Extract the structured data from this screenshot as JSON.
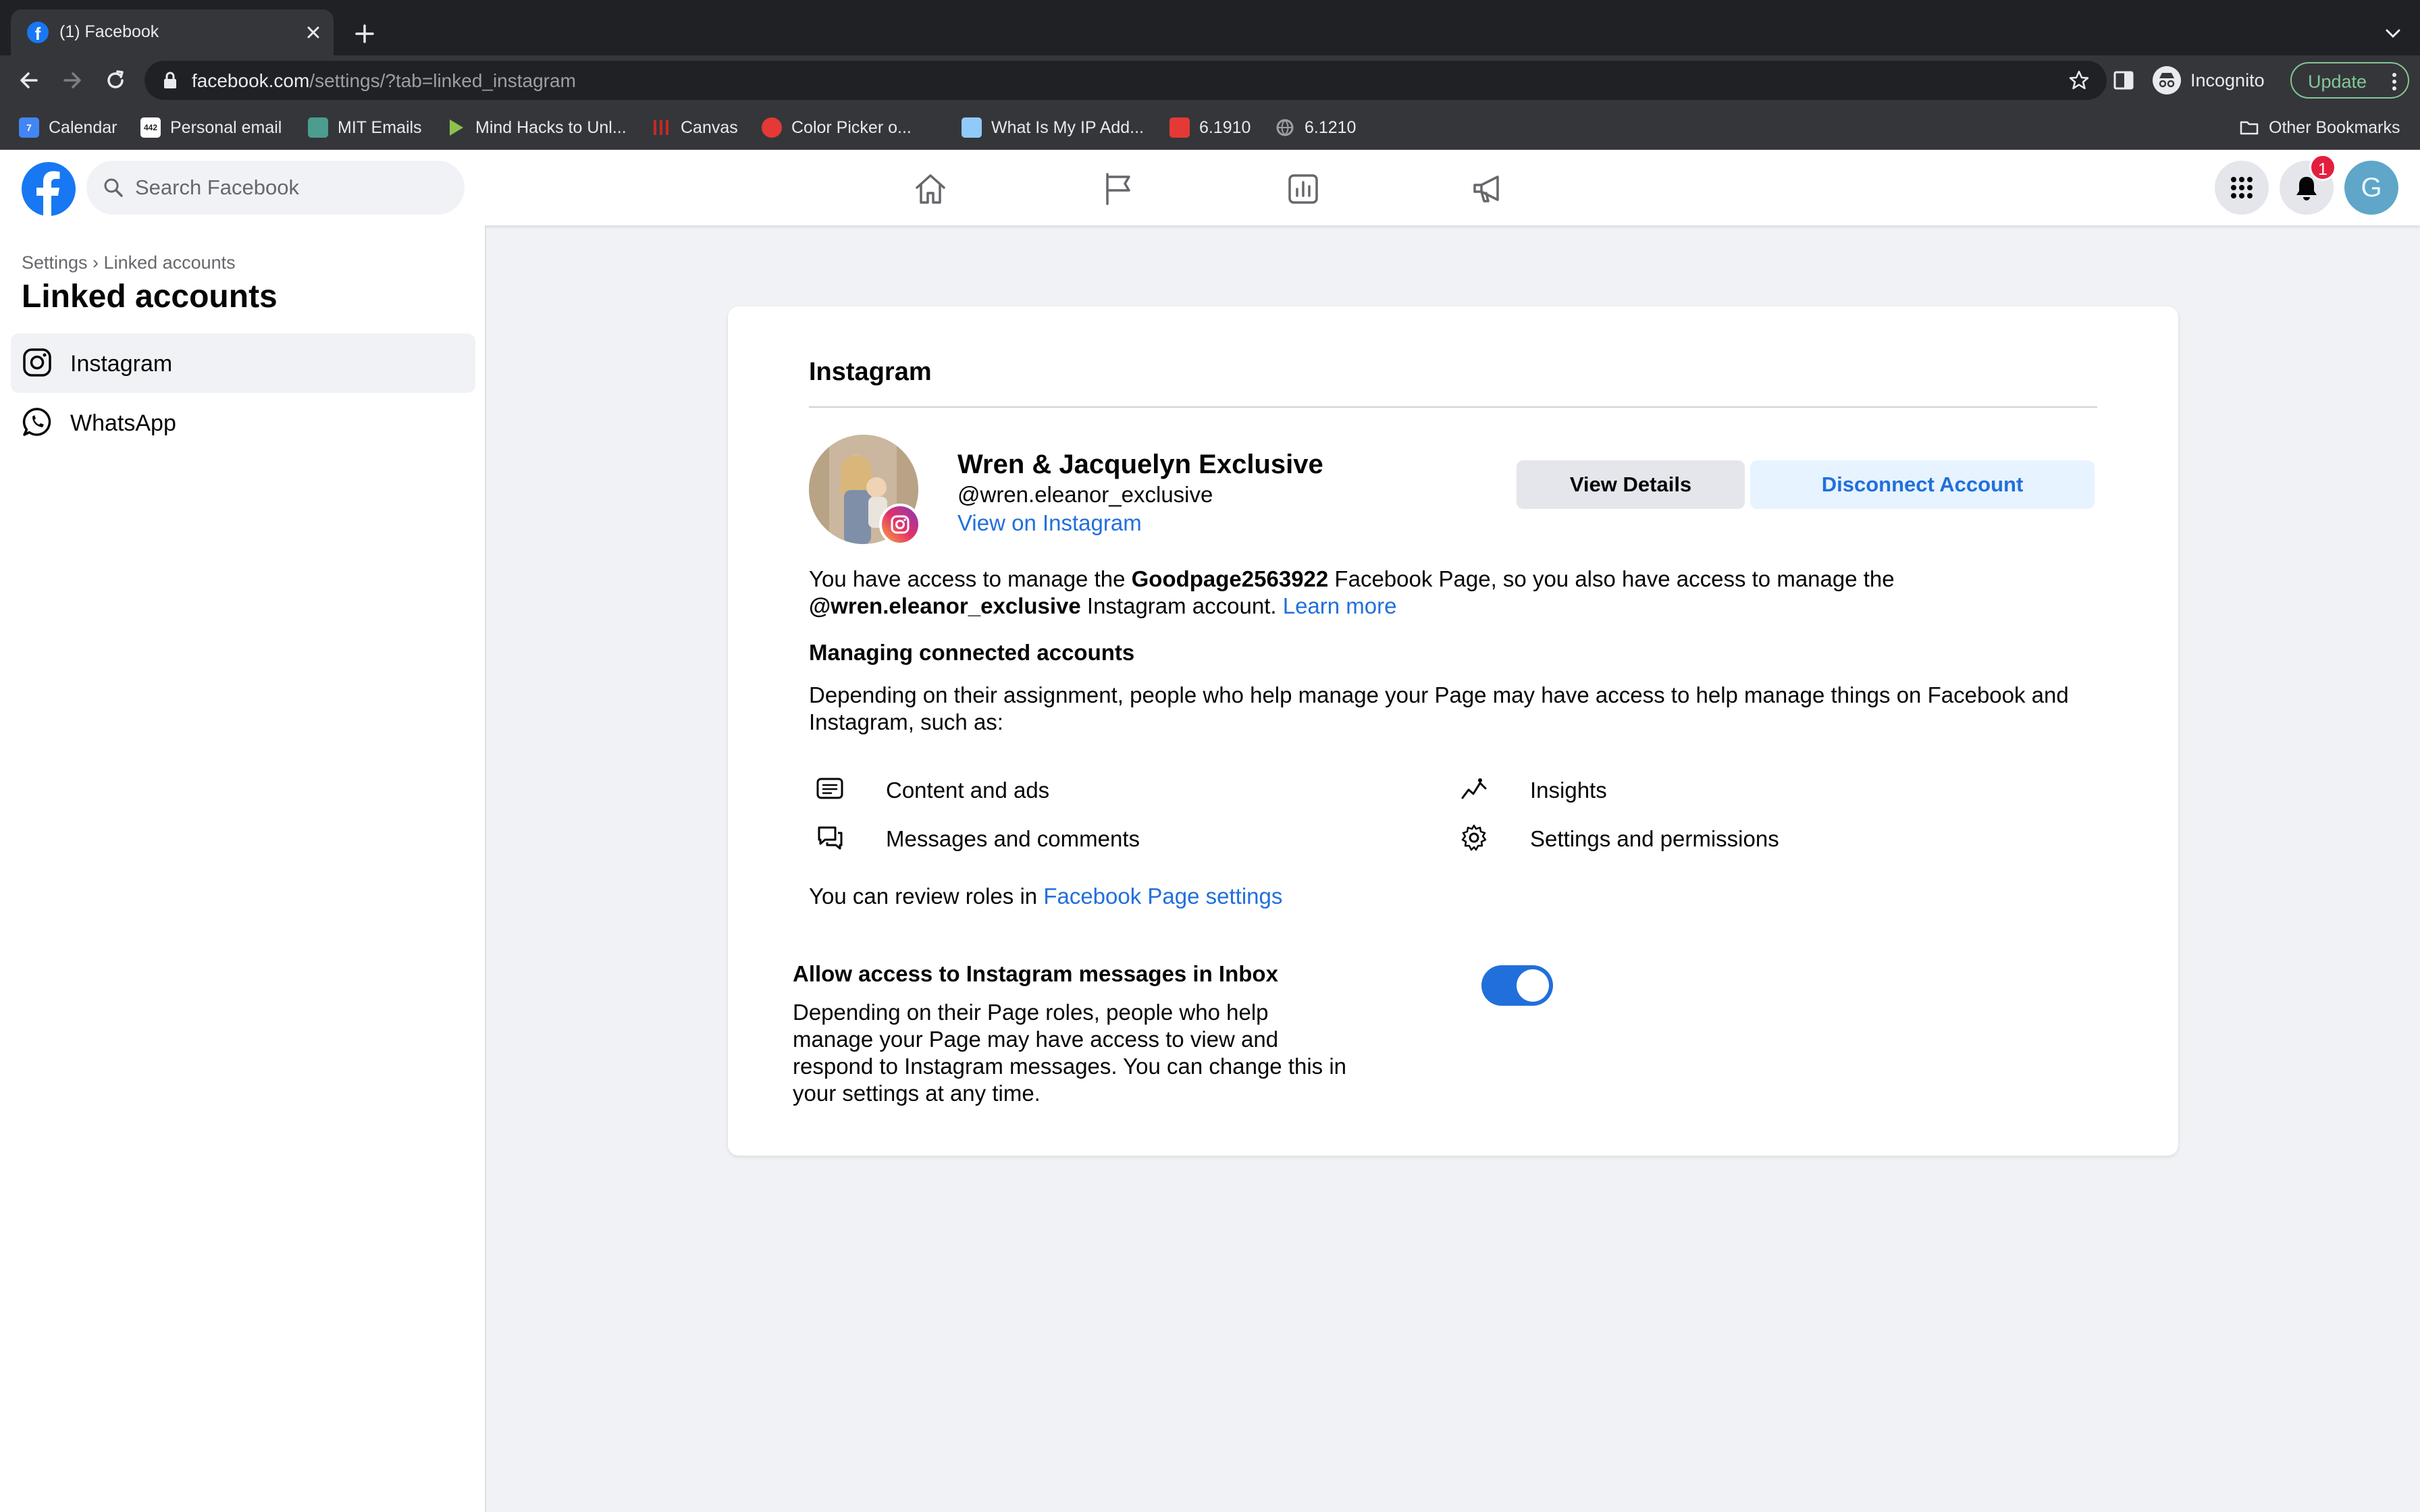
{
  "browser": {
    "tab_title": "(1) Facebook",
    "url_host": "facebook.com",
    "url_path": "/settings/?tab=linked_instagram",
    "incognito_label": "Incognito",
    "update_label": "Update",
    "bookmarks": [
      {
        "label": "Calendar",
        "icon": "calendar-icon",
        "color": "#4285f4"
      },
      {
        "label": "Personal email",
        "icon": "email-icon",
        "color": "#ffffff"
      },
      {
        "label": "MIT Emails",
        "icon": "mit-icon",
        "color": "#4a9d8f"
      },
      {
        "label": "Mind Hacks to Unl...",
        "icon": "play-icon",
        "color": "#8bc34a"
      },
      {
        "label": "Canvas",
        "icon": "canvas-icon",
        "color": "#c62828"
      },
      {
        "label": "Color Picker o...",
        "icon": "color-picker-icon",
        "color": "#e53935"
      },
      {
        "label": "What Is My IP Add...",
        "icon": "ip-icon",
        "color": "#90caf9"
      },
      {
        "label": "6.1910",
        "icon": "course-icon",
        "color": "#e53935"
      },
      {
        "label": "6.1210",
        "icon": "globe-icon",
        "color": "#9aa0a6"
      }
    ],
    "other_bookmarks": "Other Bookmarks"
  },
  "header": {
    "search_placeholder": "Search Facebook",
    "notification_count": "1",
    "avatar_initial": "G"
  },
  "sidebar": {
    "breadcrumb": "Settings › Linked accounts",
    "title": "Linked accounts",
    "items": [
      {
        "label": "Instagram",
        "icon": "instagram-icon",
        "active": true
      },
      {
        "label": "WhatsApp",
        "icon": "whatsapp-icon",
        "active": false
      }
    ]
  },
  "card": {
    "title": "Instagram",
    "account_name": "Wren & Jacquelyn Exclusive",
    "account_handle": "@wren.eleanor_exclusive",
    "view_on_instagram": "View on Instagram",
    "view_details_button": "View Details",
    "disconnect_button": "Disconnect Account",
    "access_text": {
      "p1": "You have access to manage the ",
      "page_name": "Goodpage2563922",
      "p2": " Facebook Page, so you also have access to manage the",
      "handle": "@wren.eleanor_exclusive",
      "p3": " Instagram account. ",
      "learn_more": "Learn more"
    },
    "managing_heading": "Managing connected accounts",
    "managing_text": "Depending on their assignment, people who help manage your Page may have access to help manage things on Facebook and Instagram, such as:",
    "features": [
      {
        "label": "Content and ads",
        "icon": "content-ads-icon"
      },
      {
        "label": "Insights",
        "icon": "insights-icon"
      },
      {
        "label": "Messages and comments",
        "icon": "messages-icon"
      },
      {
        "label": "Settings and permissions",
        "icon": "gear-icon"
      }
    ],
    "review_text": "You can review roles in ",
    "review_link": "Facebook Page settings",
    "inbox_heading": "Allow access to Instagram messages in Inbox",
    "inbox_text": "Depending on their Page roles, people who help manage your Page may have access to view and respond to Instagram messages. You can change this in your settings at any time.",
    "inbox_toggle_on": true
  },
  "colors": {
    "facebook_blue": "#1877f2",
    "link_blue": "#216fdb",
    "page_bg": "#f0f2f5"
  }
}
